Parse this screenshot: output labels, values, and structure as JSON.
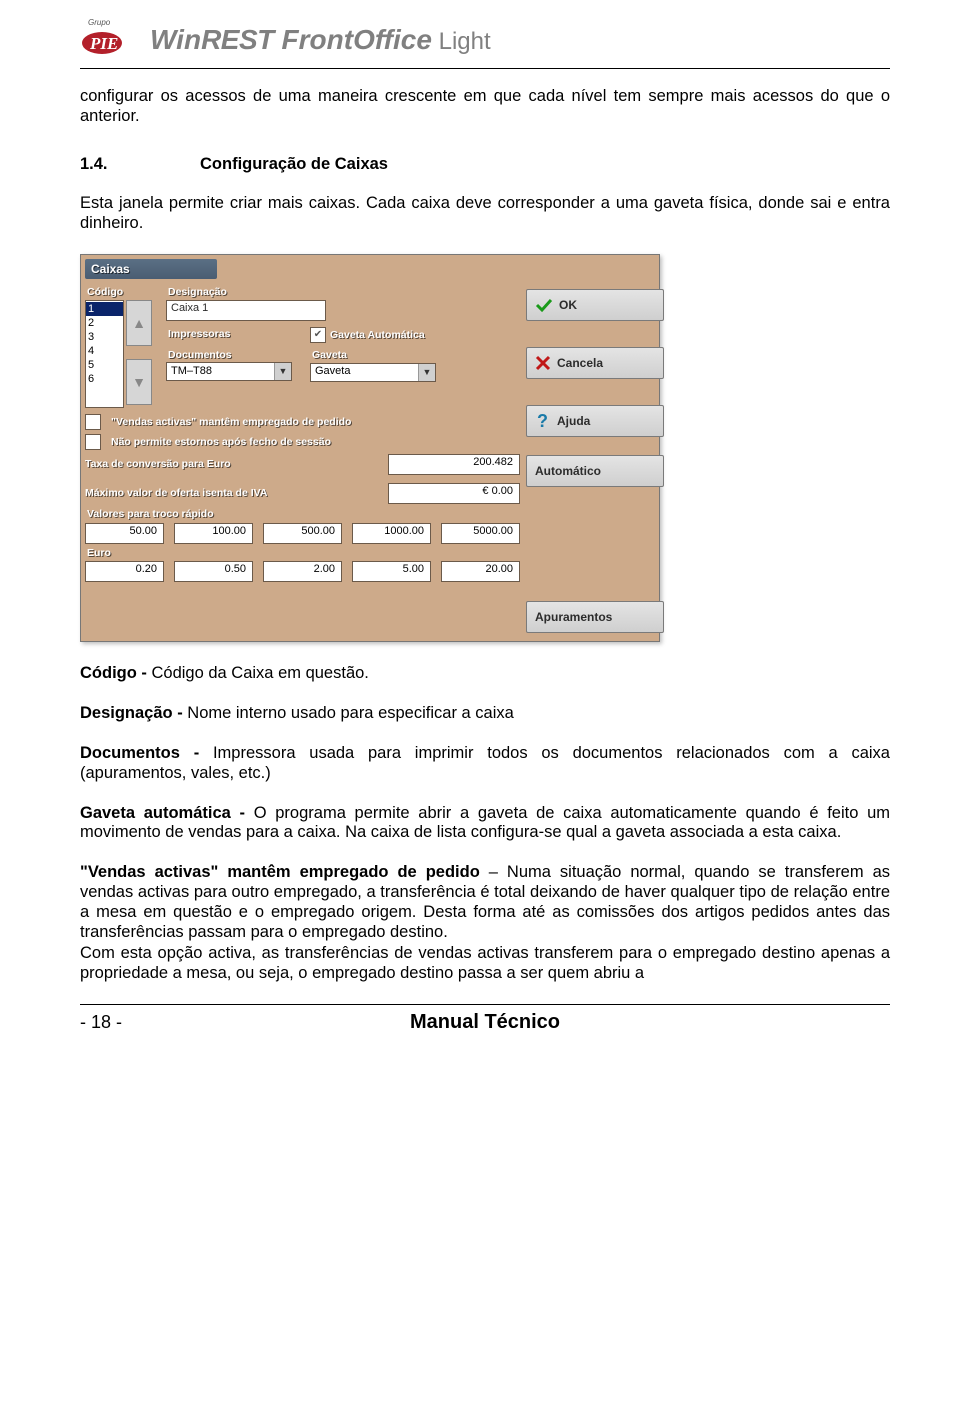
{
  "header": {
    "grupo": "Grupo",
    "product_win": "Win",
    "product_rest": "REST",
    "product_fo": " FrontOffice",
    "product_light": " Light"
  },
  "intro": "configurar os acessos de uma maneira crescente em que cada nível tem sempre mais acessos do que o anterior.",
  "section": {
    "num": "1.4.",
    "title": "Configuração de Caixas"
  },
  "p1": "Esta janela permite criar mais caixas. Cada caixa deve corresponder a uma gaveta física, donde sai e entra dinheiro.",
  "shot": {
    "title": "Caixas",
    "codLabel": "Código",
    "codes": [
      "1",
      "2",
      "3",
      "4",
      "5",
      "6"
    ],
    "desLabel": "Designação",
    "desValue": "Caixa 1",
    "impLabel": "Impressoras",
    "docLabel": "Documentos",
    "docValue": "TM–T88",
    "gavAutoLabel": "Gaveta Automática",
    "gavLabel": "Gaveta",
    "gavValue": "Gaveta",
    "opt1": "\"Vendas activas\" mantêm empregado de pedido",
    "opt2": "Não permite estornos após fecho de sessão",
    "taxaLabel": "Taxa de conversão para Euro",
    "taxaValue": "200.482",
    "maxLabel": "Máximo valor de oferta isenta de IVA",
    "maxValue": "€ 0.00",
    "trocoLabel": "Valores para troco rápido",
    "trocoVals": [
      "50.00",
      "100.00",
      "500.00",
      "1000.00",
      "5000.00"
    ],
    "euroLabel": "Euro",
    "euroVals": [
      "0.20",
      "0.50",
      "2.00",
      "5.00",
      "20.00"
    ],
    "btns": {
      "ok": "OK",
      "cancel": "Cancela",
      "help": "Ajuda",
      "auto": "Automático",
      "apur": "Apuramentos"
    }
  },
  "defs": {
    "codigo_b": "Código -",
    "codigo": " Código da Caixa em questão.",
    "desig_b": "Designação -",
    "desig": " Nome interno usado para especificar a caixa",
    "doc_b": "Documentos -",
    "doc": " Impressora usada para imprimir todos os documentos relacionados com a caixa (apuramentos, vales, etc.)",
    "gav_b": "Gaveta automática -",
    "gav": " O programa permite abrir a gaveta de caixa automaticamente quando é feito um movimento de vendas para a caixa. Na caixa de lista configura-se qual a gaveta associada a esta caixa.",
    "vend_b": "\"Vendas activas\" mantêm empregado de pedido",
    "vend": " – Numa situação normal, quando se transferem as vendas activas para outro empregado, a transferência é total deixando de haver qualquer tipo de relação entre a mesa em questão e o empregado origem. Desta forma até as comissões dos artigos pedidos antes das transferências passam para o empregado destino.",
    "vend2": "Com esta opção activa, as transferências de vendas activas transferem para o empregado destino apenas a propriedade a mesa, ou seja, o empregado destino passa a ser quem abriu a"
  },
  "footer": {
    "page": "- 18 -",
    "title": "Manual Técnico"
  }
}
